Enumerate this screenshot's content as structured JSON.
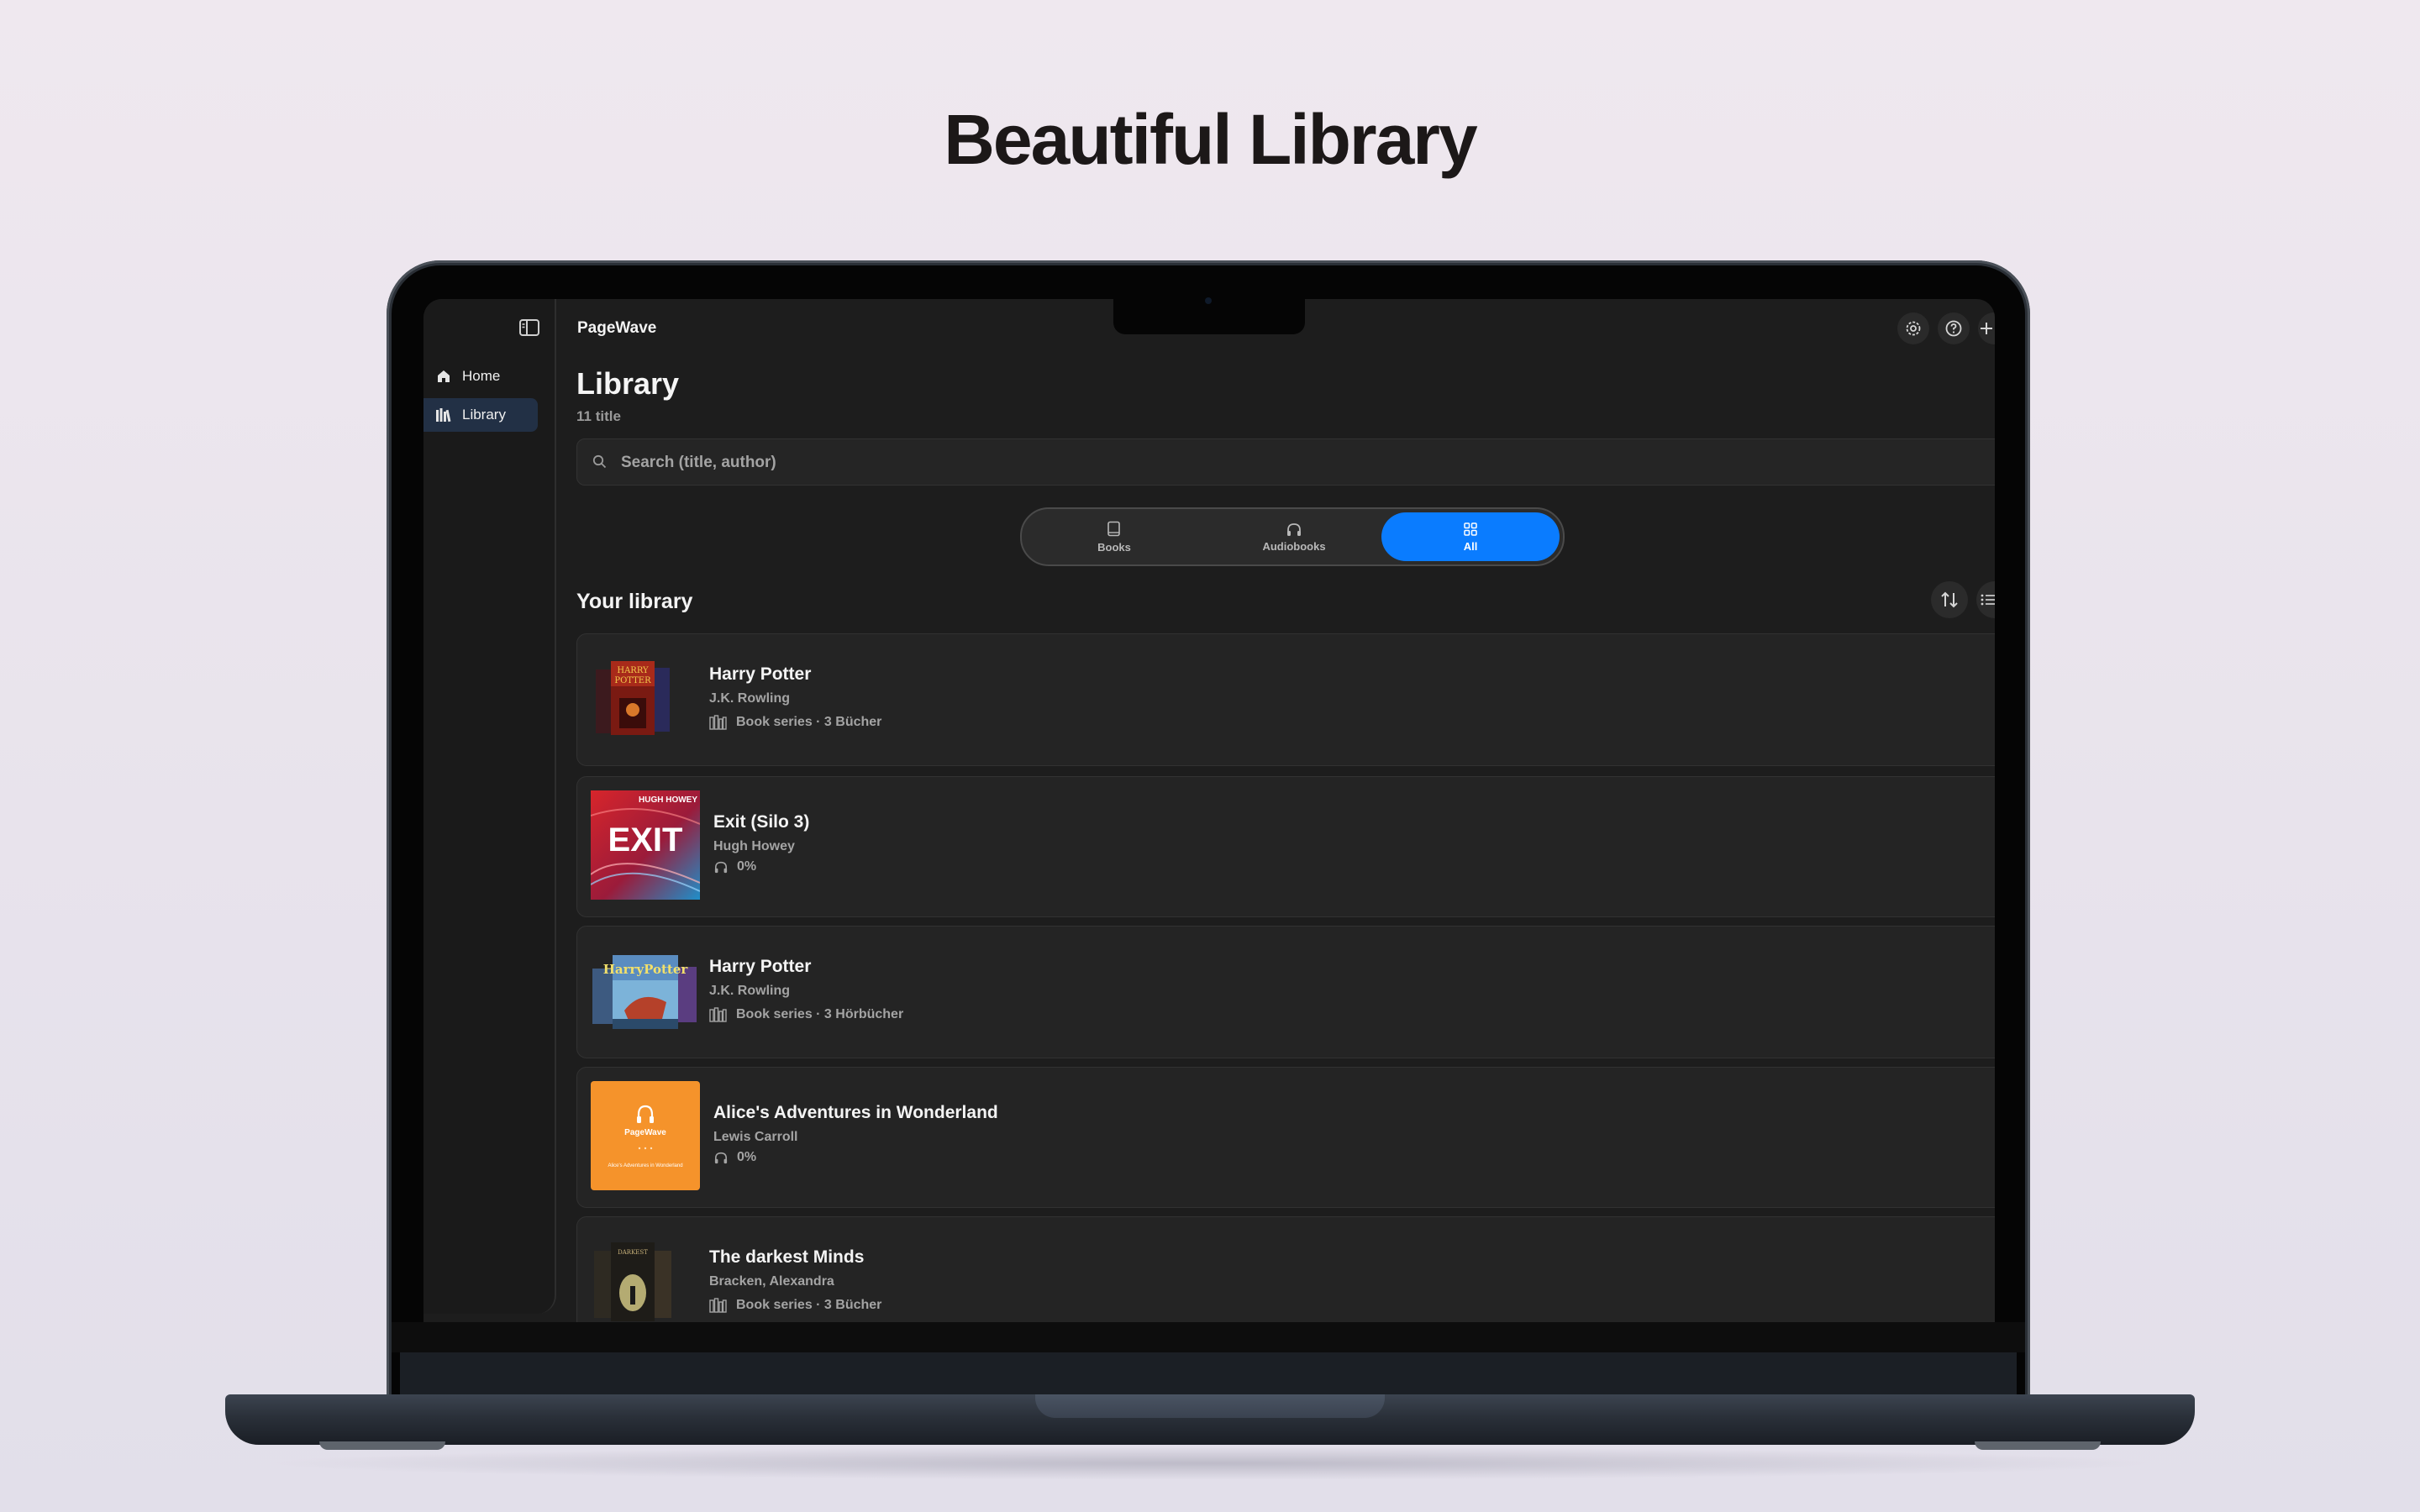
{
  "headline": "Beautiful Library",
  "app": {
    "name": "PageWave"
  },
  "sidebar": {
    "items": [
      {
        "label": "Home",
        "icon": "house-icon",
        "active": false
      },
      {
        "label": "Library",
        "icon": "library-icon",
        "active": true
      }
    ]
  },
  "main": {
    "title": "Library",
    "count": "11 title",
    "search_placeholder": "Search (title, author)",
    "segments": [
      {
        "label": "Books",
        "icon": "book-icon",
        "active": false
      },
      {
        "label": "Audiobooks",
        "icon": "headphones-icon",
        "active": false
      },
      {
        "label": "All",
        "icon": "grid-icon",
        "active": true
      }
    ],
    "section_title": "Your library",
    "items": [
      {
        "title": "Harry Potter",
        "author": "J.K. Rowling",
        "meta": "Book series · 3 Bücher",
        "meta_icon": "library-icon",
        "has_chevron": true
      },
      {
        "title": "Exit (Silo 3)",
        "author": "Hugh Howey",
        "meta": "0%",
        "meta_icon": "headphones-icon",
        "has_chevron": false,
        "cover_text": "EXIT",
        "cover_top": "HUGH HOWEY"
      },
      {
        "title": "Harry Potter",
        "author": "J.K. Rowling",
        "meta": "Book series · 3 Hörbücher",
        "meta_icon": "library-icon",
        "has_chevron": true
      },
      {
        "title": "Alice's Adventures in Wonderland",
        "author": "Lewis Carroll",
        "meta": "0%",
        "meta_icon": "headphones-icon",
        "has_chevron": false,
        "cover_brand": "PageWave",
        "cover_caption": "Alice's Adventures in Wonderland"
      },
      {
        "title": "The darkest Minds",
        "author": "Bracken, Alexandra",
        "meta": "Book series · 3 Bücher",
        "meta_icon": "library-icon",
        "has_chevron": true
      }
    ]
  },
  "colors": {
    "accent": "#0a7cff",
    "cover_orange": "#f5932b",
    "background": "#1d1d1d"
  }
}
